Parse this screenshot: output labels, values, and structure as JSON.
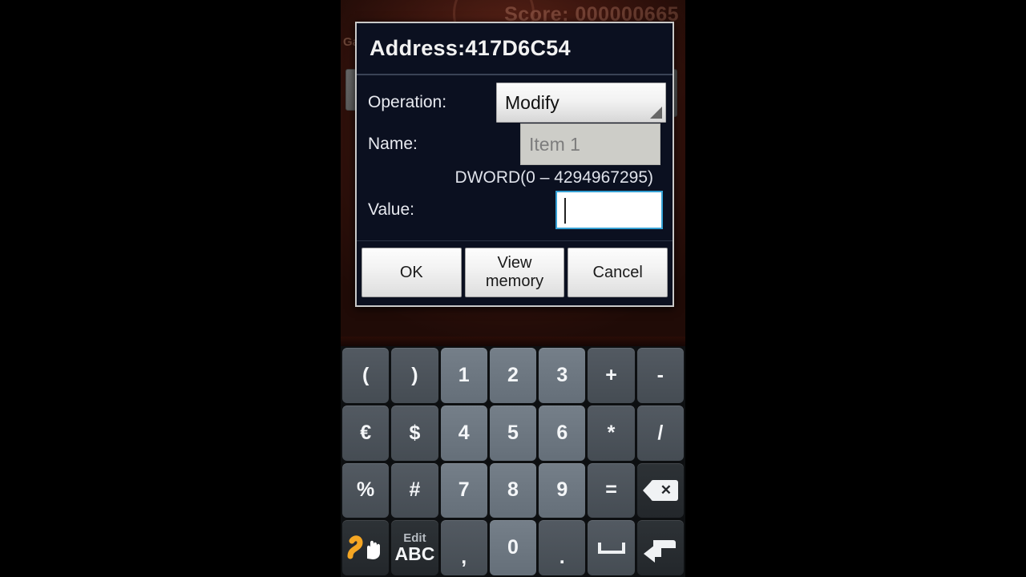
{
  "background": {
    "score_text": "Score: 000000665",
    "left_label": "Ga",
    "colors": {
      "base": "#4a1a11",
      "highlight": "#5e2418"
    }
  },
  "dialog": {
    "title": "Address:417D6C54",
    "fields": {
      "operation_label": "Operation:",
      "operation_value": "Modify",
      "name_label": "Name:",
      "name_placeholder": "Item 1",
      "range_hint": "DWORD(0 – 4294967295)",
      "value_label": "Value:",
      "value_text": ""
    },
    "buttons": [
      {
        "id": "ok",
        "label": "OK"
      },
      {
        "id": "view-memory",
        "label": "View\nmemory"
      },
      {
        "id": "cancel",
        "label": "Cancel"
      }
    ],
    "colors": {
      "body": "#0b1020",
      "border": "#c9c9c9",
      "focus": "#35a0d4"
    }
  },
  "keyboard": {
    "rows": [
      [
        {
          "id": "paren-open",
          "label": "(",
          "type": "sym"
        },
        {
          "id": "paren-close",
          "label": ")",
          "type": "sym"
        },
        {
          "id": "digit-1",
          "label": "1",
          "type": "num"
        },
        {
          "id": "digit-2",
          "label": "2",
          "type": "num"
        },
        {
          "id": "digit-3",
          "label": "3",
          "type": "num"
        },
        {
          "id": "plus",
          "label": "+",
          "type": "sym"
        },
        {
          "id": "minus",
          "label": "-",
          "type": "sym"
        }
      ],
      [
        {
          "id": "euro",
          "label": "€",
          "type": "sym"
        },
        {
          "id": "dollar",
          "label": "$",
          "type": "sym"
        },
        {
          "id": "digit-4",
          "label": "4",
          "type": "num"
        },
        {
          "id": "digit-5",
          "label": "5",
          "type": "num"
        },
        {
          "id": "digit-6",
          "label": "6",
          "type": "num"
        },
        {
          "id": "asterisk",
          "label": "*",
          "type": "sym"
        },
        {
          "id": "slash",
          "label": "/",
          "type": "sym"
        }
      ],
      [
        {
          "id": "percent",
          "label": "%",
          "type": "sym"
        },
        {
          "id": "hash",
          "label": "#",
          "type": "sym"
        },
        {
          "id": "digit-7",
          "label": "7",
          "type": "num"
        },
        {
          "id": "digit-8",
          "label": "8",
          "type": "num"
        },
        {
          "id": "digit-9",
          "label": "9",
          "type": "num"
        },
        {
          "id": "equals",
          "label": "=",
          "type": "sym"
        },
        {
          "id": "backspace",
          "label": "",
          "type": "dark",
          "icon": "backspace-icon"
        }
      ],
      [
        {
          "id": "swipe",
          "label": "",
          "type": "dark",
          "icon": "swipe-input-icon"
        },
        {
          "id": "edit-abc",
          "label": "",
          "type": "dark",
          "icon": "edit-abc",
          "label_top": "Edit",
          "label_bottom": "ABC"
        },
        {
          "id": "comma",
          "label": ",",
          "type": "sym"
        },
        {
          "id": "digit-0",
          "label": "0",
          "type": "num"
        },
        {
          "id": "period",
          "label": ".",
          "type": "sym"
        },
        {
          "id": "space",
          "label": "",
          "type": "sym",
          "icon": "space-icon"
        },
        {
          "id": "enter",
          "label": "",
          "type": "dark",
          "icon": "enter-icon"
        }
      ]
    ]
  }
}
